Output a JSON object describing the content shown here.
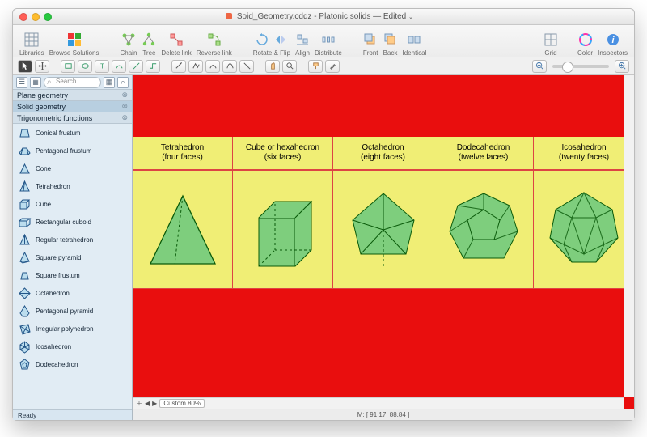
{
  "title": {
    "file": "Soid_Geometry.cddz",
    "doc": "Platonic solids",
    "edited": "Edited"
  },
  "toolbar": {
    "libraries": "Libraries",
    "browse": "Browse Solutions",
    "chain": "Chain",
    "tree": "Tree",
    "delete": "Delete link",
    "reverse": "Reverse link",
    "rotate": "Rotate & Flip",
    "align": "Align",
    "distribute": "Distribute",
    "front": "Front",
    "back": "Back",
    "identical": "Identical",
    "grid": "Grid",
    "color": "Color",
    "inspectors": "Inspectors"
  },
  "sidebar": {
    "search_placeholder": "Search",
    "cats": [
      "Plane geometry",
      "Solid geometry",
      "Trigonometric functions"
    ],
    "shapes": [
      "Conical frustum",
      "Pentagonal frustum",
      "Cone",
      "Tetrahedron",
      "Cube",
      "Rectangular cuboid",
      "Regular tetrahedron",
      "Square pyramid",
      "Square frustum",
      "Octahedron",
      "Pentagonal pyramid",
      "Irregular polyhedron",
      "Icosahedron",
      "Dodecahedron"
    ],
    "status": "Ready"
  },
  "solids": [
    {
      "name": "Tetrahedron",
      "sub": "(four faces)"
    },
    {
      "name": "Cube or hexahedron",
      "sub": "(six faces)"
    },
    {
      "name": "Octahedron",
      "sub": "(eight faces)"
    },
    {
      "name": "Dodecahedron",
      "sub": "(twelve faces)"
    },
    {
      "name": "Icosahedron",
      "sub": "(twenty faces)"
    }
  ],
  "scroll": {
    "zoom": "Custom 80%"
  },
  "footer": {
    "coords": "M: [ 91.17, 88.84 ]"
  },
  "colors": {
    "fill": "#7ece7d",
    "stroke": "#0a5a0a",
    "bg": "#e90e0e",
    "band": "#f0ee75"
  }
}
